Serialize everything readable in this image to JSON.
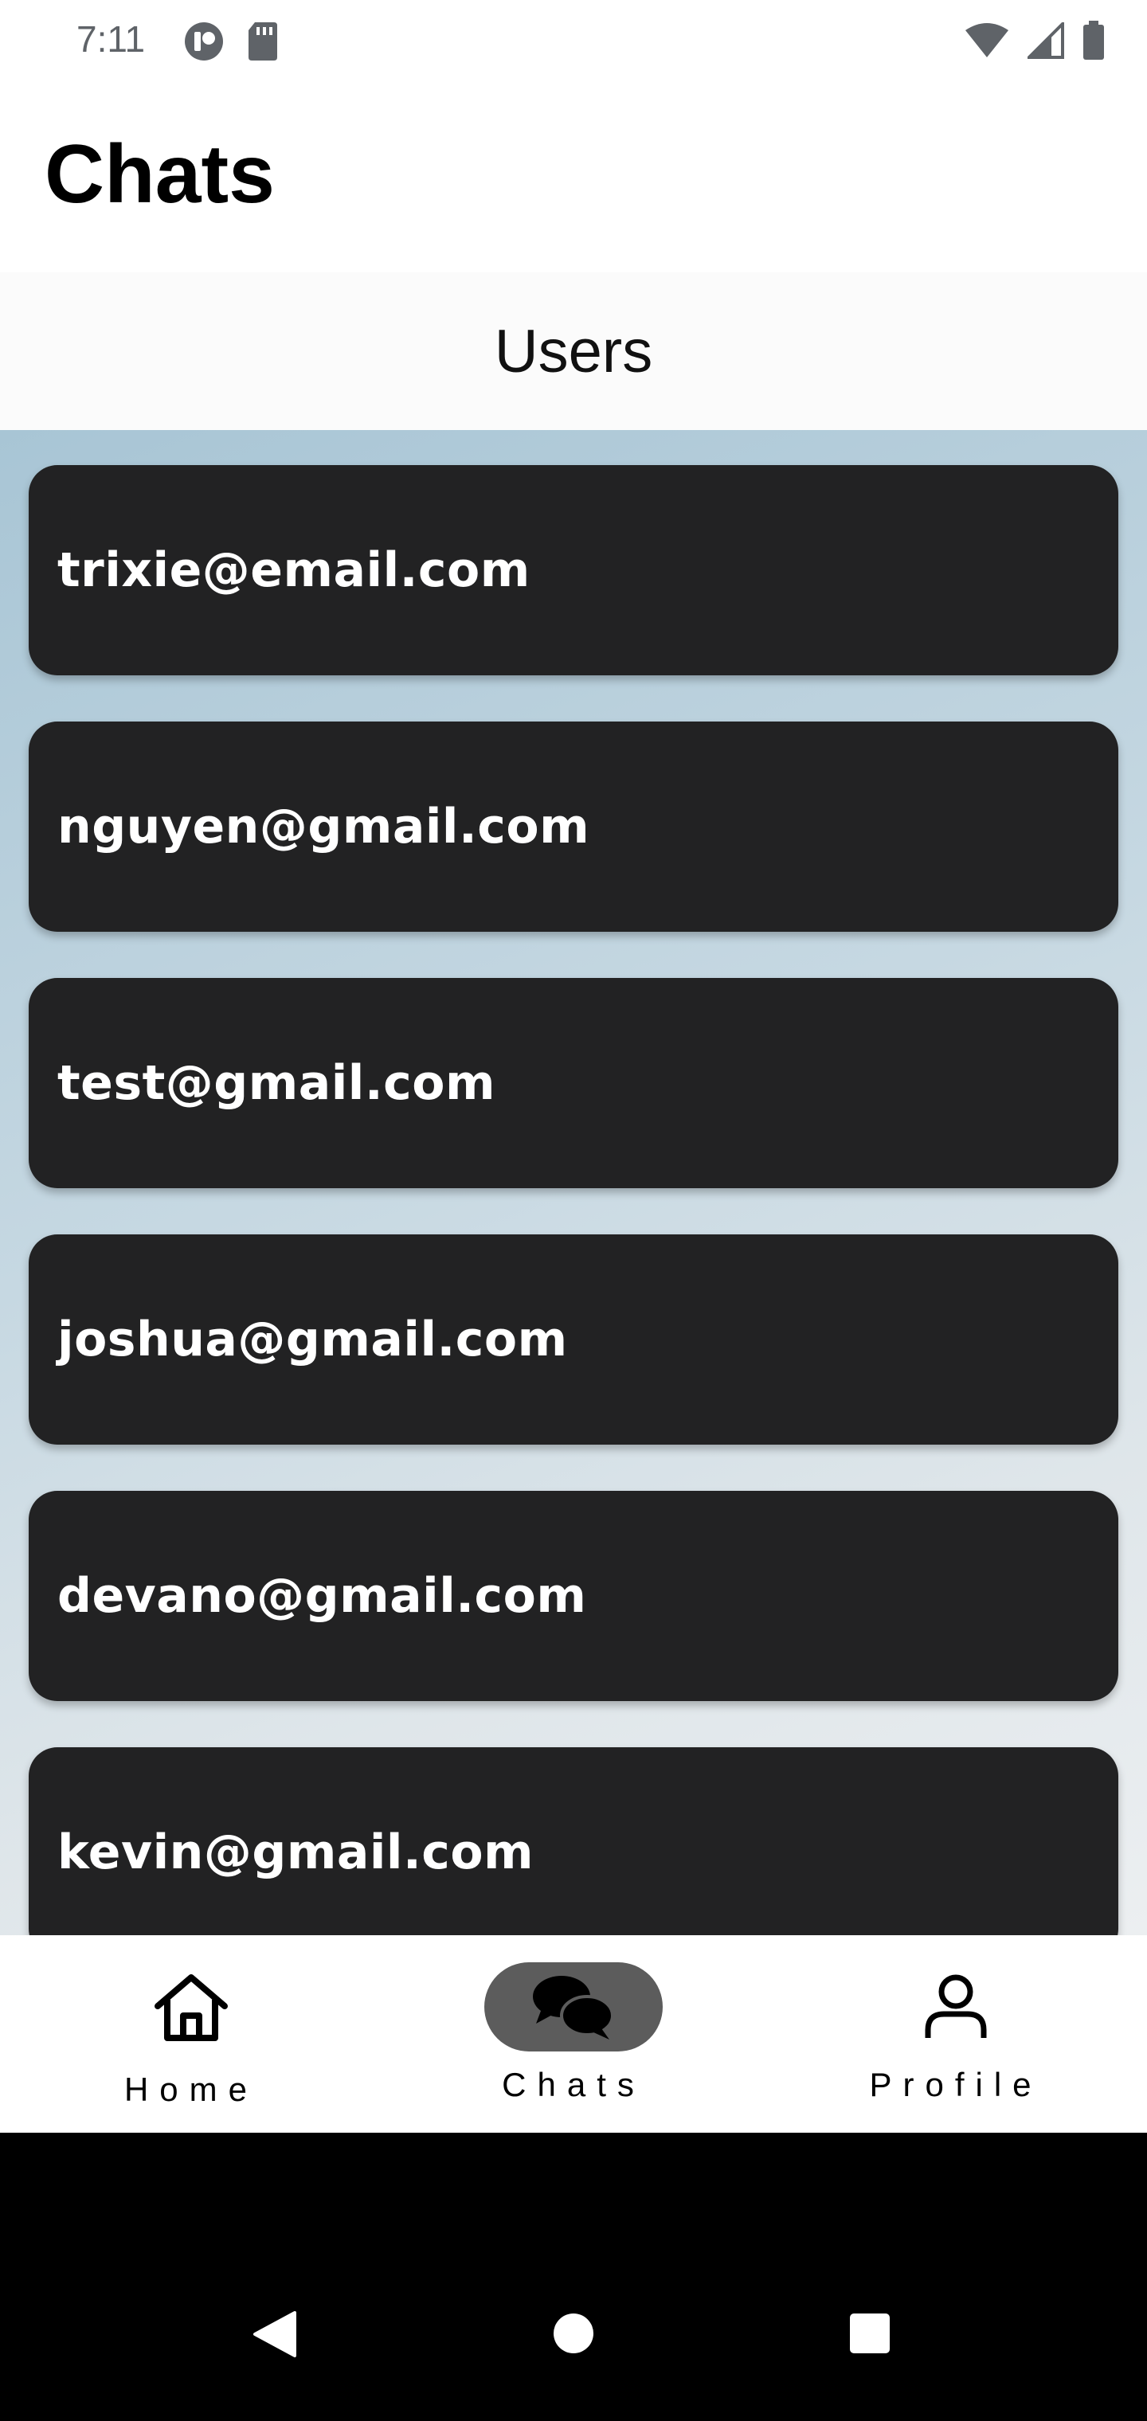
{
  "status_bar": {
    "time": "7:11"
  },
  "app": {
    "title": "Chats"
  },
  "users_header": {
    "label": "Users"
  },
  "users": [
    "trixie@email.com",
    "nguyen@gmail.com",
    "test@gmail.com",
    "joshua@gmail.com",
    "devano@gmail.com",
    "kevin@gmail.com"
  ],
  "bottom_nav": {
    "items": [
      {
        "label": "Home",
        "icon": "home-icon",
        "active": false
      },
      {
        "label": "Chats",
        "icon": "chat-bubbles-icon",
        "active": true
      },
      {
        "label": "Profile",
        "icon": "person-icon",
        "active": false
      }
    ]
  },
  "colors": {
    "card_bg": "#222223",
    "active_pill": "#5c5c5c",
    "list_gradient_start": "#a8c5d5",
    "list_gradient_end": "#eceff1"
  }
}
